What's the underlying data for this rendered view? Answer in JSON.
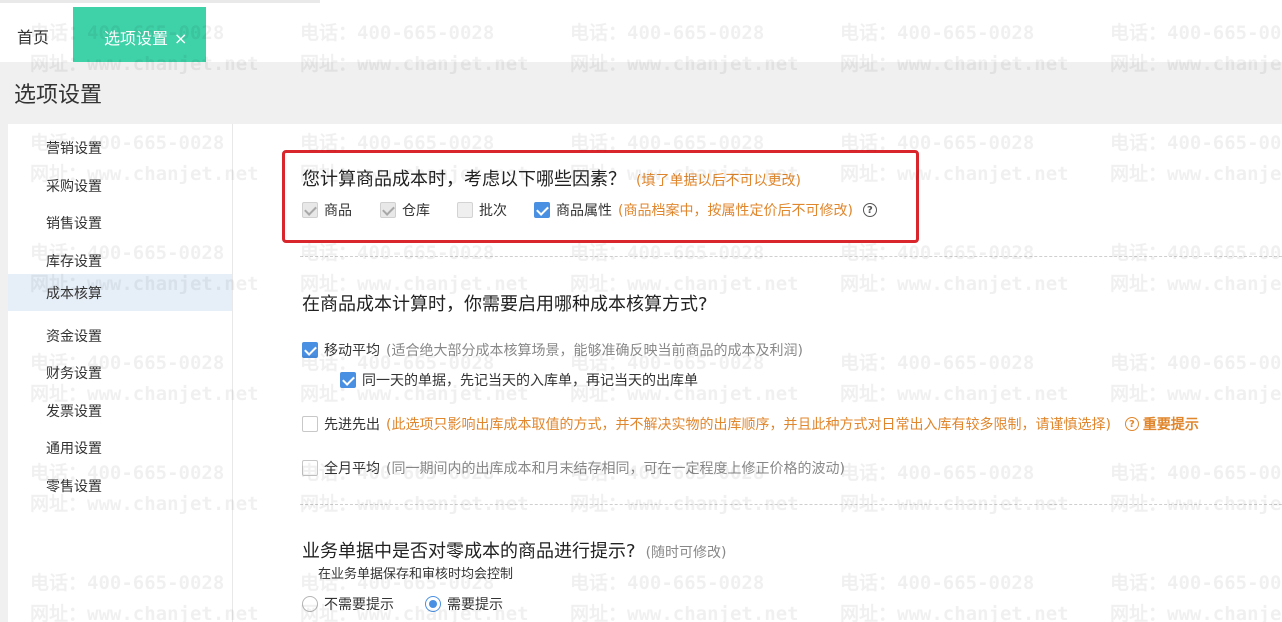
{
  "tabs": {
    "home_label": "首页",
    "active_label": "选项设置",
    "close_glyph": "×"
  },
  "page_title": "选项设置",
  "sidebar": {
    "items": [
      {
        "label": "营销设置"
      },
      {
        "label": "采购设置"
      },
      {
        "label": "销售设置"
      },
      {
        "label": "库存设置"
      },
      {
        "label": "成本核算",
        "active": true
      },
      {
        "label": "资金设置"
      },
      {
        "label": "财务设置"
      },
      {
        "label": "发票设置"
      },
      {
        "label": "通用设置"
      },
      {
        "label": "零售设置"
      }
    ]
  },
  "section1": {
    "title": "您计算商品成本时，考虑以下哪些因素？",
    "note": "(填了单据以后不可以更改)",
    "options": [
      {
        "label": "商品",
        "checked": true,
        "disabled": true
      },
      {
        "label": "仓库",
        "checked": true,
        "disabled": true
      },
      {
        "label": "批次",
        "checked": false,
        "disabled": true
      },
      {
        "label": "商品属性",
        "checked": true,
        "disabled": false
      }
    ],
    "attr_note": "(商品档案中，按属性定价后不可修改)",
    "help_icon": "?"
  },
  "section2": {
    "title": "在商品成本计算时，你需要启用哪种成本核算方式?",
    "moving_avg": {
      "label": "移动平均",
      "note": "(适合绝大部分成本核算场景，能够准确反映当前商品的成本及利润)",
      "checked": true
    },
    "same_day": {
      "label": "同一天的单据，先记当天的入库单，再记当天的出库单",
      "checked": true
    },
    "fifo": {
      "label": "先进先出",
      "note": "(此选项只影响出库成本取值的方式，并不解决实物的出库顺序，并且此种方式对日常出入库有较多限制，请谨慎选择)",
      "checked": false,
      "important_label": "重要提示"
    },
    "monthly_avg": {
      "label": "全月平均",
      "note": "(同一期间内的出库成本和月末结存相同，可在一定程度上修正价格的波动)",
      "checked": false
    }
  },
  "section3": {
    "title": "业务单据中是否对零成本的商品进行提示?",
    "note": "(随时可修改)",
    "subtitle": "在业务单据保存和审核时均会控制",
    "options": [
      {
        "label": "不需要提示",
        "selected": false
      },
      {
        "label": "需要提示",
        "selected": true
      }
    ]
  },
  "watermark": {
    "phone": "电话：400-665-0028",
    "site": "网址：www.chanjet.net"
  },
  "colors": {
    "tab_active": "#3fd1a8",
    "accent": "#4a90e2",
    "warning": "#e0862c",
    "highlight": "#d9262c"
  }
}
